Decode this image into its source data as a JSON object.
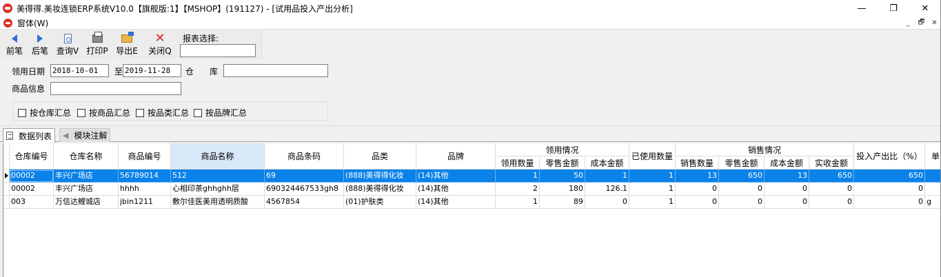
{
  "window": {
    "title": "美得得.美妆连锁ERP系统V10.0【旗舰版:1】【MSHOP】(191127) - [试用品投入产出分析]",
    "min": "—",
    "max": "❐",
    "close": "✕"
  },
  "menu": {
    "window_label": "窗体(W)",
    "mdi_min": "_",
    "mdi_restore": "🗗",
    "mdi_close": "✕"
  },
  "toolbar": {
    "prev": "前笔",
    "next": "后笔",
    "query": "查询V",
    "print": "打印P",
    "export": "导出E",
    "close": "关闭Q",
    "report_label": "报表选择:",
    "report_value": ""
  },
  "filter": {
    "date_label": "领用日期",
    "date_from": "2018-10-01",
    "to_label": "至",
    "date_to": "2019-11-28",
    "warehouse_label_1": "仓",
    "warehouse_label_2": "库",
    "warehouse_value": "",
    "product_label": "商品信息",
    "product_value": "",
    "checkboxes": [
      "按仓库汇总",
      "按商品汇总",
      "按品类汇总",
      "按品牌汇总"
    ]
  },
  "tabs": {
    "data_list": "数据列表",
    "module_notes": "模块注解"
  },
  "grid": {
    "headers": {
      "wh_code": "仓库编号",
      "wh_name": "仓库名称",
      "prod_code": "商品编号",
      "prod_name": "商品名称",
      "barcode": "商品条码",
      "category": "品类",
      "brand": "品牌",
      "use_group": "领用情况",
      "use_qty": "领用数量",
      "retail_amt": "零售金额",
      "cost_amt": "成本金额",
      "used_qty": "已使用数量",
      "sale_group": "销售情况",
      "sale_qty": "销售数量",
      "sale_retail": "零售金额",
      "sale_cost": "成本金额",
      "received": "实收金额",
      "ratio": "投入产出比（%）",
      "unit": "单"
    },
    "rows": [
      [
        "00002",
        "丰兴广场店",
        "56789014",
        "512",
        "69",
        "(888)美得得化妆",
        "(14)其他",
        "1",
        "50",
        "1",
        "1",
        "13",
        "650",
        "13",
        "650",
        "650",
        ""
      ],
      [
        "00002",
        "丰兴广场店",
        "hhhh",
        "心相印茶ghhghh层",
        "690324467533gh8",
        "(888)美得得化妆",
        "(14)其他",
        "2",
        "180",
        "126.1",
        "1",
        "0",
        "0",
        "0",
        "0",
        "0",
        ""
      ],
      [
        "003",
        "万信达鲤城店",
        "jbin1211",
        "敷尔佳医美用透明质酸",
        "4567854",
        "(01)护肤类",
        "(14)其他",
        "1",
        "89",
        "0",
        "1",
        "0",
        "0",
        "0",
        "0",
        "0",
        "g"
      ]
    ]
  }
}
